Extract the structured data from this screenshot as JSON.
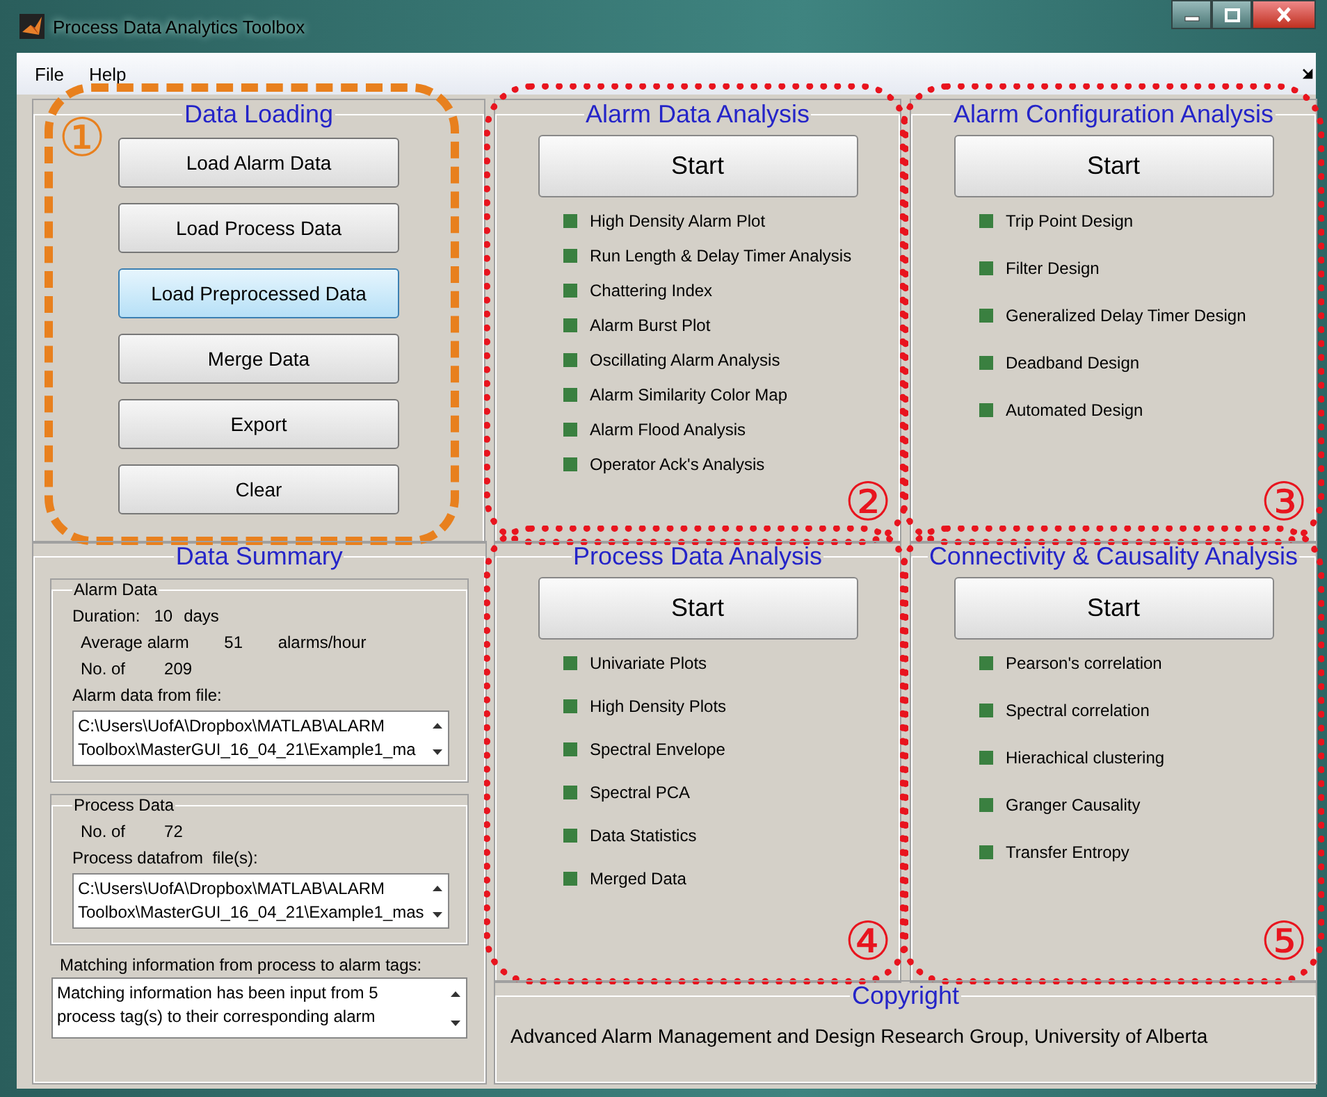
{
  "window": {
    "title": "Process Data Analytics Toolbox"
  },
  "menu": [
    {
      "label": "File"
    },
    {
      "label": "Help"
    }
  ],
  "data_loading": {
    "title": "Data Loading",
    "annotation": {
      "number": "①",
      "color": "#e8801e",
      "kind": "dashed"
    },
    "buttons": [
      {
        "label": "Load Alarm Data",
        "focused": false
      },
      {
        "label": "Load Process Data",
        "focused": false
      },
      {
        "label": "Load Preprocessed Data",
        "focused": true
      },
      {
        "label": "Merge Data",
        "focused": false
      },
      {
        "label": "Export",
        "focused": false
      },
      {
        "label": "Clear",
        "focused": false
      }
    ]
  },
  "data_summary": {
    "title": "Data Summary",
    "alarm_data": {
      "title": "Alarm Data",
      "duration_label": "Duration:",
      "duration_value": "10",
      "duration_unit": "days",
      "average_label": "Average alarm",
      "average_value": "51",
      "average_unit": "alarms/hour",
      "count_label": "No. of",
      "count_value": "209",
      "file_label": "Alarm data from file:",
      "file_lines": [
        "C:\\Users\\UofA\\Dropbox\\MATLAB\\ALARM",
        "Toolbox\\MasterGUI_16_04_21\\Example1_ma"
      ]
    },
    "process_data": {
      "title": "Process Data",
      "count_label": "No. of",
      "count_value": "72",
      "file_label": "Process datafrom  file(s):",
      "file_lines": [
        "C:\\Users\\UofA\\Dropbox\\MATLAB\\ALARM",
        "Toolbox\\MasterGUI_16_04_21\\Example1_mas"
      ]
    },
    "matching_label": "Matching information from process to alarm tags:",
    "matching_lines": [
      "Matching information has been input from 5",
      "process tag(s) to their corresponding alarm"
    ]
  },
  "analyses": [
    {
      "title": "Alarm Data Analysis",
      "button": "Start",
      "annotation": {
        "number": "②",
        "color": "#e8141e",
        "kind": "dotted"
      },
      "items": [
        "High Density Alarm Plot",
        "Run Length & Delay Timer Analysis",
        "Chattering Index",
        "Alarm Burst Plot",
        "Oscillating Alarm Analysis",
        "Alarm Similarity Color Map",
        "Alarm Flood Analysis",
        "Operator Ack's Analysis"
      ]
    },
    {
      "title": "Alarm Configuration Analysis",
      "button": "Start",
      "annotation": {
        "number": "③",
        "color": "#e8141e",
        "kind": "dotted"
      },
      "items": [
        "Trip Point Design",
        "Filter Design",
        "Generalized Delay Timer Design",
        "Deadband Design",
        "Automated Design"
      ]
    },
    {
      "title": "Process Data Analysis",
      "button": "Start",
      "annotation": {
        "number": "④",
        "color": "#e8141e",
        "kind": "dotted"
      },
      "items": [
        "Univariate Plots",
        "High Density Plots",
        "Spectral Envelope",
        "Spectral PCA",
        "Data Statistics",
        "Merged Data"
      ]
    },
    {
      "title": "Connectivity & Causality Analysis",
      "button": "Start",
      "annotation": {
        "number": "⑤",
        "color": "#e8141e",
        "kind": "dotted"
      },
      "items": [
        "Pearson's correlation",
        "Spectral correlation",
        "Hierachical clustering",
        "Granger Causality",
        "Transfer Entropy"
      ]
    }
  ],
  "copyright": {
    "title": "Copyright",
    "text": "Advanced Alarm Management and Design Research Group, University of Alberta"
  }
}
